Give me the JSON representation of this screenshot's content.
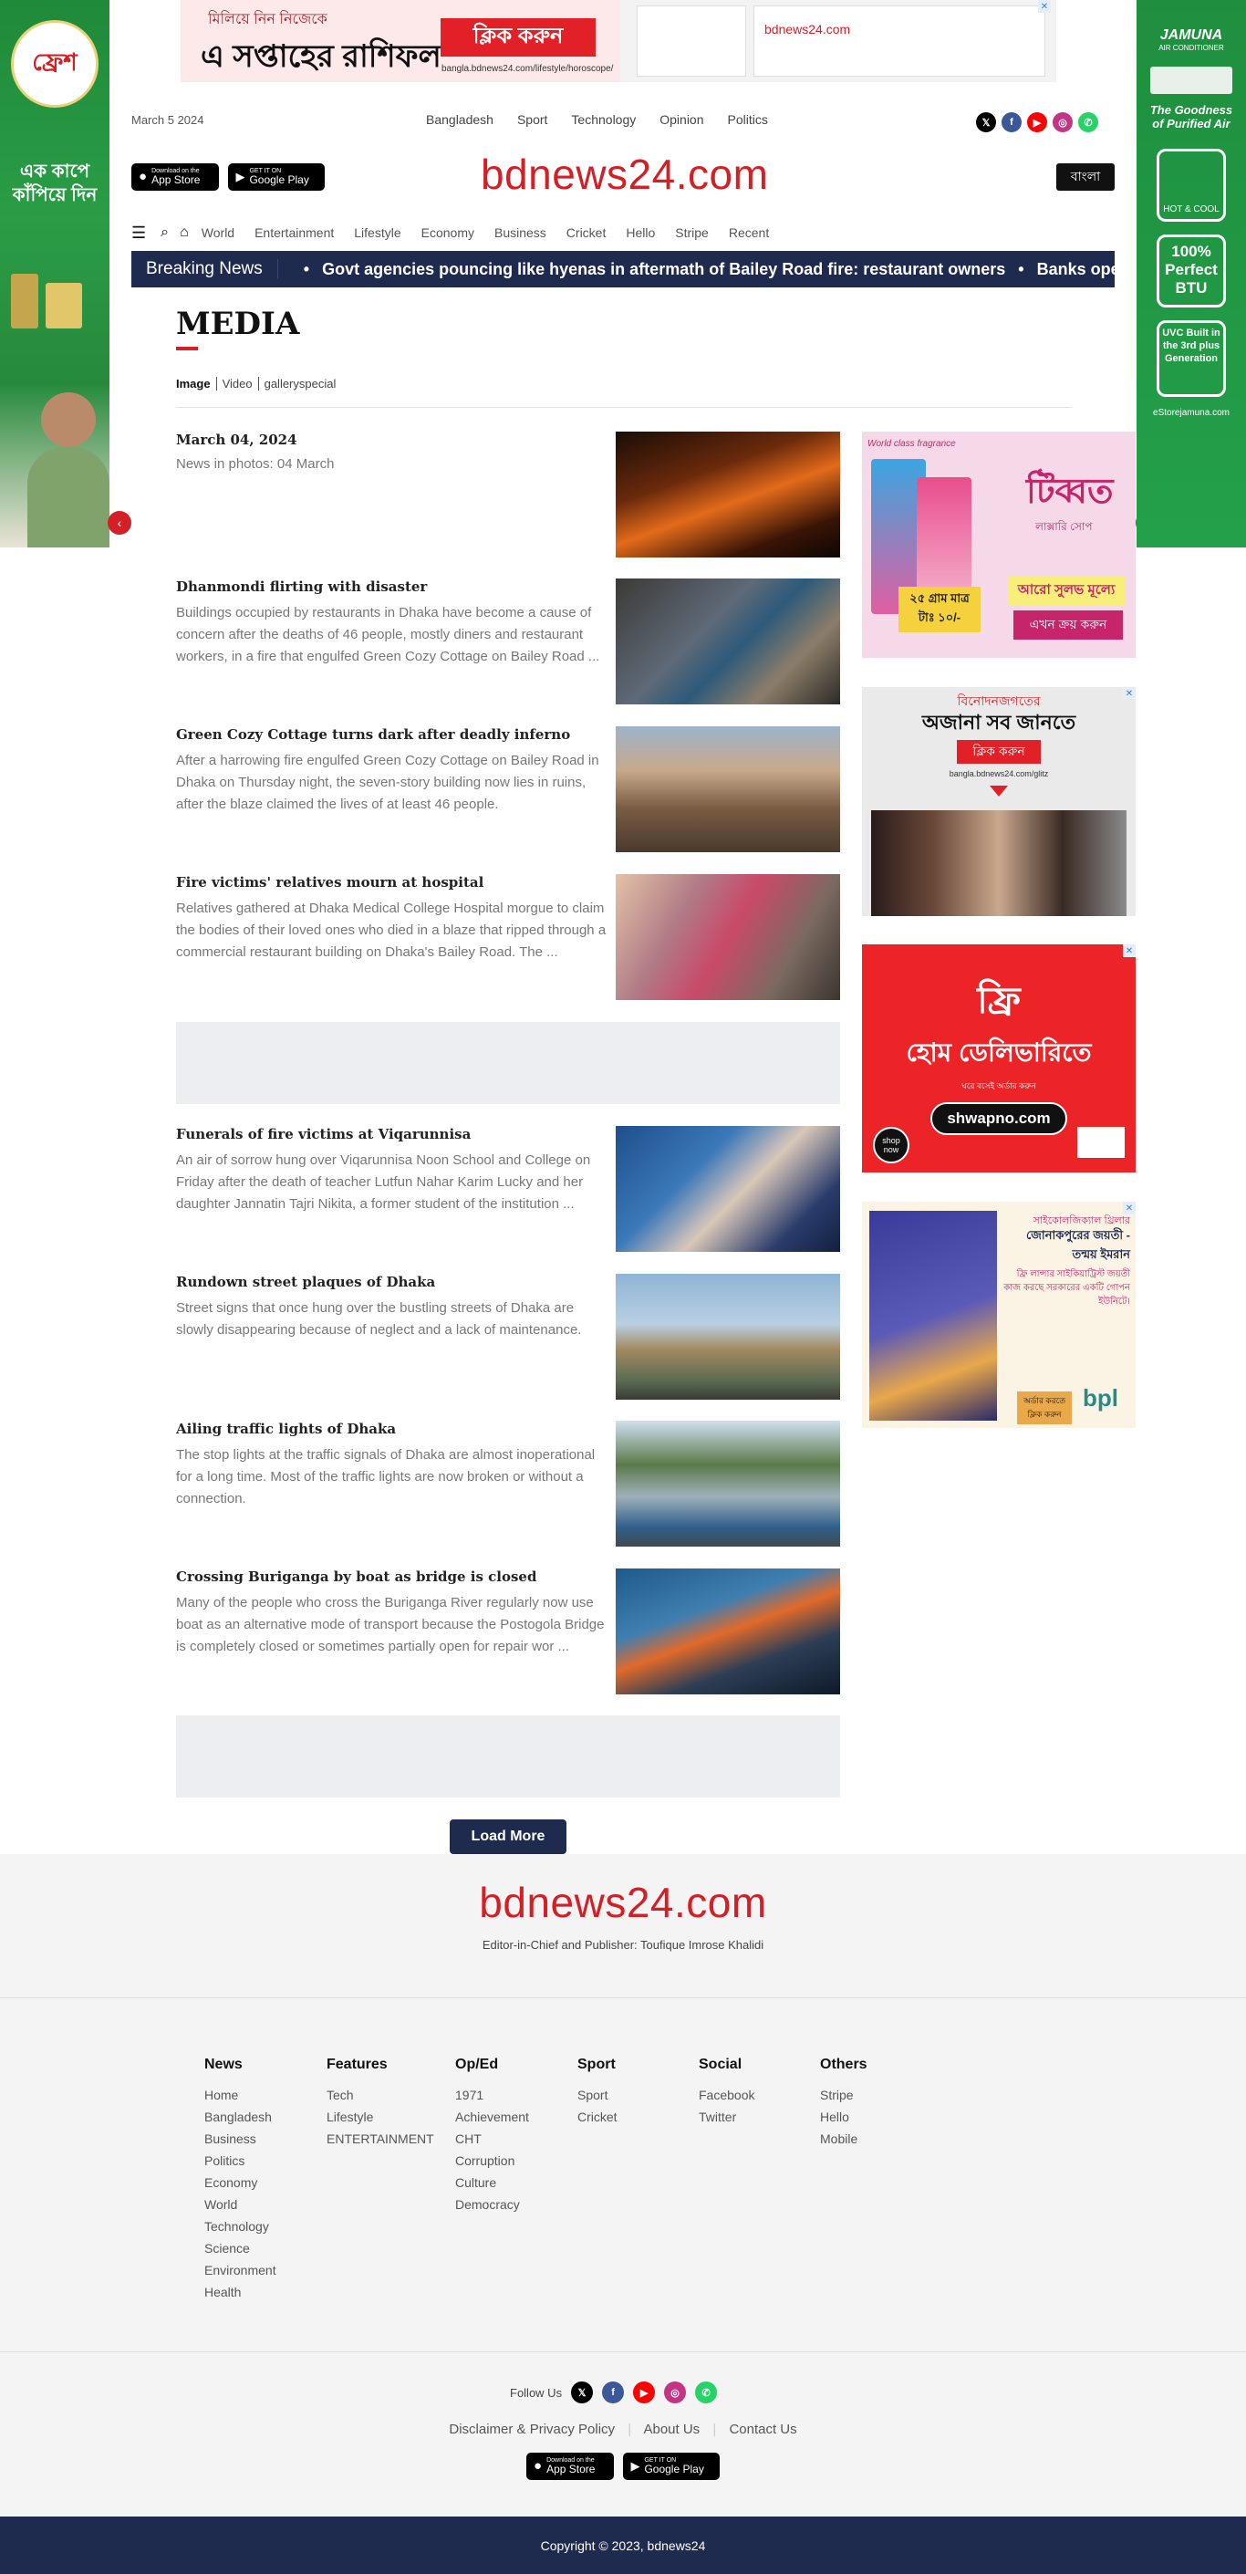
{
  "header": {
    "date": "March 5 2024",
    "top_nav": [
      "Bangladesh",
      "Sport",
      "Technology",
      "Opinion",
      "Politics"
    ],
    "logo": "bdnews24.com",
    "lang_button": "বাংলা",
    "app_store": {
      "small": "Download on the",
      "big": "App Store"
    },
    "google_play": {
      "small": "GET IT ON",
      "big": "Google Play"
    }
  },
  "main_nav": [
    "World",
    "Entertainment",
    "Lifestyle",
    "Economy",
    "Business",
    "Cricket",
    "Hello",
    "Stripe",
    "Recent"
  ],
  "breaking": {
    "label": "Breaking News",
    "items": [
      "Govt agencies pouncing like hyenas in aftermath of Bailey Road fire: restaurant owners",
      "Banks oper"
    ]
  },
  "page": {
    "title": "MEDIA",
    "subtabs": [
      "Image",
      "Video",
      "galleryspecial"
    ]
  },
  "articles": [
    {
      "date": "March 04, 2024",
      "title": "",
      "summary": "News in photos: 04 March"
    },
    {
      "date": "",
      "title": "Dhanmondi flirting with disaster",
      "summary": "Buildings occupied by restaurants in Dhaka have become a cause of concern after the deaths of 46 people, mostly diners and restaurant workers, in a fire that engulfed Green Cozy Cottage on Bailey Road ..."
    },
    {
      "date": "",
      "title": "Green Cozy Cottage turns dark after deadly inferno",
      "summary": "After a harrowing fire engulfed Green Cozy Cottage on Bailey Road in Dhaka on Thursday night, the seven-story building now lies in ruins, after the blaze claimed the lives of at least 46 people."
    },
    {
      "date": "",
      "title": "Fire victims' relatives mourn at hospital",
      "summary": "Relatives gathered at Dhaka Medical College Hospital morgue to claim the bodies of their loved ones who died in a blaze that ripped through a commercial restaurant building on Dhaka's Bailey Road. The ..."
    },
    {
      "date": "",
      "title": "Funerals of fire victims at Viqarunnisa",
      "summary": "An air of sorrow hung over Viqarunnisa Noon School and College on Friday after the death of teacher Lutfun Nahar Karim Lucky and her daughter Jannatin Tajri Nikita, a former student of the institution ..."
    },
    {
      "date": "",
      "title": "Rundown street plaques of Dhaka",
      "summary": "Street signs that once hung over the bustling streets of Dhaka are slowly disappearing because of neglect and a lack of maintenance."
    },
    {
      "date": "",
      "title": "Ailing traffic lights of Dhaka",
      "summary": "The stop lights at the traffic signals of Dhaka are almost inoperational for a long time. Most of the traffic lights are now broken or without a connection."
    },
    {
      "date": "",
      "title": "Crossing Buriganga by boat as bridge is closed",
      "summary": "Many of the people who cross the Buriganga River regularly now use boat as an alternative mode of transport because the Postogola Bridge is completely closed or sometimes partially open for repair wor ..."
    }
  ],
  "load_more": "Load More",
  "ads": {
    "top": {
      "line1": "মিলিয়ে নিন নিজেকে",
      "line2": "এ সপ্তাহের রাশিফল",
      "button": "ক্লিক করুন",
      "url": "bangla.bdnews24.com/lifestyle/horoscope/"
    },
    "left": {
      "brand": "ফ্রেশ",
      "tagline": "এক কাপে কাঁপিয়ে দিন"
    },
    "right": {
      "brand": "JAMUNA",
      "sub": "AIR CONDITIONER",
      "slogan": "The Goodness of Purified Air",
      "badge1": "HOT & COOL",
      "badge2": "100% Perfect BTU",
      "badge3": "UVC Built in the 3rd plus Generation",
      "store": "eStorejamuna.com"
    },
    "side1": {
      "tag": "World class fragrance",
      "brand": "টিব্বত",
      "sub": "লাক্সারি সোপ",
      "price": "২৫ গ্রাম মাত্র টাঃ ১০/-",
      "cta1": "আরো সুলভ মূল্যে",
      "cta2": "এখন ক্রয় করুন"
    },
    "side2": {
      "line1": "বিনোদনজগতের",
      "line2": "অজানা সব জানতে",
      "button": "ক্লিক করুন",
      "url": "bangla.bdnews24.com/glitz"
    },
    "side3": {
      "line1": "ফ্রি",
      "line2": "হোম ডেলিভারিতে",
      "sub": "ঘরে বসেই অর্ডার করুন",
      "url": "shwapno.com",
      "shop": "shop now"
    },
    "side4": {
      "line1": "সাইকোলজিক্যাল থ্রিলার",
      "line2": "জোনাকপুরের জয়তী - তন্ময় ইমরান",
      "body": "ফ্রি লান্সার সাইকিয়াট্রিস্ট জয়তী কাজ করছে সরকারের একটি গোপন ইউনিটে।",
      "cta": "অর্ডার করতে ক্লিক করুন",
      "brand": "bpl"
    }
  },
  "footer": {
    "logo": "bdnews24.com",
    "editor": "Editor-in-Chief and Publisher: Toufique Imrose Khalidi",
    "columns": [
      {
        "title": "News",
        "links": [
          "Home",
          "Bangladesh",
          "Business",
          "Politics",
          "Economy",
          "World",
          "Technology",
          "Science",
          "Environment",
          "Health"
        ]
      },
      {
        "title": "Features",
        "links": [
          "Tech",
          "Lifestyle",
          "ENTERTAINMENT"
        ]
      },
      {
        "title": "Op/Ed",
        "links": [
          "1971",
          "Achievement",
          "CHT",
          "Corruption",
          "Culture",
          "Democracy"
        ]
      },
      {
        "title": "Sport",
        "links": [
          "Sport",
          "Cricket"
        ]
      },
      {
        "title": "Social",
        "links": [
          "Facebook",
          "Twitter"
        ]
      },
      {
        "title": "Others",
        "links": [
          "Stripe",
          "Hello",
          "Mobile"
        ]
      }
    ],
    "follow_us": "Follow Us",
    "legal": [
      "Disclaimer & Privacy Policy",
      "About Us",
      "Contact Us"
    ],
    "copyright": "Copyright © 2023, bdnews24"
  },
  "colors": {
    "brand_red": "#d32027",
    "navy": "#1f2a4f",
    "twitter": "#000000",
    "facebook": "#3b5998",
    "youtube": "#ff0000",
    "instagram": "#c13584",
    "whatsapp": "#25d366"
  }
}
